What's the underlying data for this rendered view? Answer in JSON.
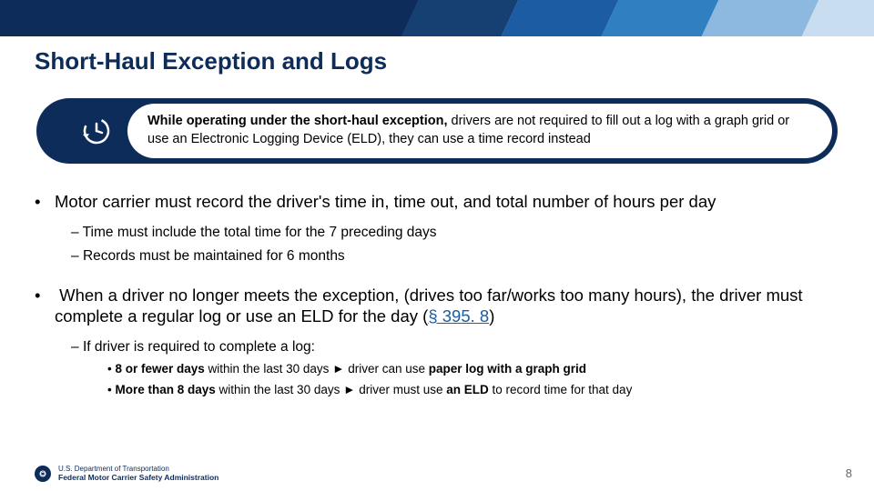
{
  "title": "Short-Haul Exception and Logs",
  "callout": {
    "bold": "While operating under the short-haul exception,",
    "rest": " drivers are not required to fill out a log with a graph grid or use an Electronic Logging Device (ELD), they can use a time record instead"
  },
  "bullets": {
    "p1": "Motor carrier must record the driver's time in, time out, and total number of hours per day",
    "p1a": "Time must include the total time for the 7 preceding days",
    "p1b": "Records must be maintained for 6 months",
    "p2_pre": "When a driver no longer meets the exception, (drives too far/works too many hours), the driver must complete a regular log or use an ELD for the day (",
    "p2_link": "§ 395. 8",
    "p2_post": ")",
    "p2a": "If driver is required to complete a log:",
    "p2a1_b1": "8 or fewer days",
    "p2a1_mid": " within the last 30 days ► driver can use ",
    "p2a1_b2": "paper log with a graph grid",
    "p2a2_b1": "More than 8 days",
    "p2a2_mid": " within the last 30 days ► driver must use ",
    "p2a2_b2": "an ELD",
    "p2a2_end": " to record time for that day"
  },
  "footer": {
    "line1": "U.S. Department of Transportation",
    "line2": "Federal Motor Carrier Safety Administration"
  },
  "page": "8"
}
